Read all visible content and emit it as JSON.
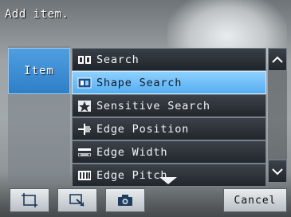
{
  "header": {
    "status": "Add item."
  },
  "left_panel": {
    "tab_label": "Item"
  },
  "list": {
    "header_label": "Search",
    "items": [
      {
        "label": "Shape Search",
        "icon": "shape-search-icon",
        "selected": true
      },
      {
        "label": "Sensitive Search",
        "icon": "sensitive-search-icon",
        "selected": false
      },
      {
        "label": "Edge Position",
        "icon": "edge-position-icon",
        "selected": false
      },
      {
        "label": "Edge Width",
        "icon": "edge-width-icon",
        "selected": false
      },
      {
        "label": "Edge Pitch",
        "icon": "edge-pitch-icon",
        "selected": false
      }
    ]
  },
  "toolbar": {
    "buttons": [
      {
        "icon": "frame-select-icon"
      },
      {
        "icon": "zoom-area-icon"
      },
      {
        "icon": "camera-icon"
      }
    ],
    "cancel_label": "Cancel"
  },
  "colors": {
    "selected_bg": "#6cbcf6",
    "tab_bg": "#3b8ad4",
    "row_bg": "#2a2f35"
  }
}
